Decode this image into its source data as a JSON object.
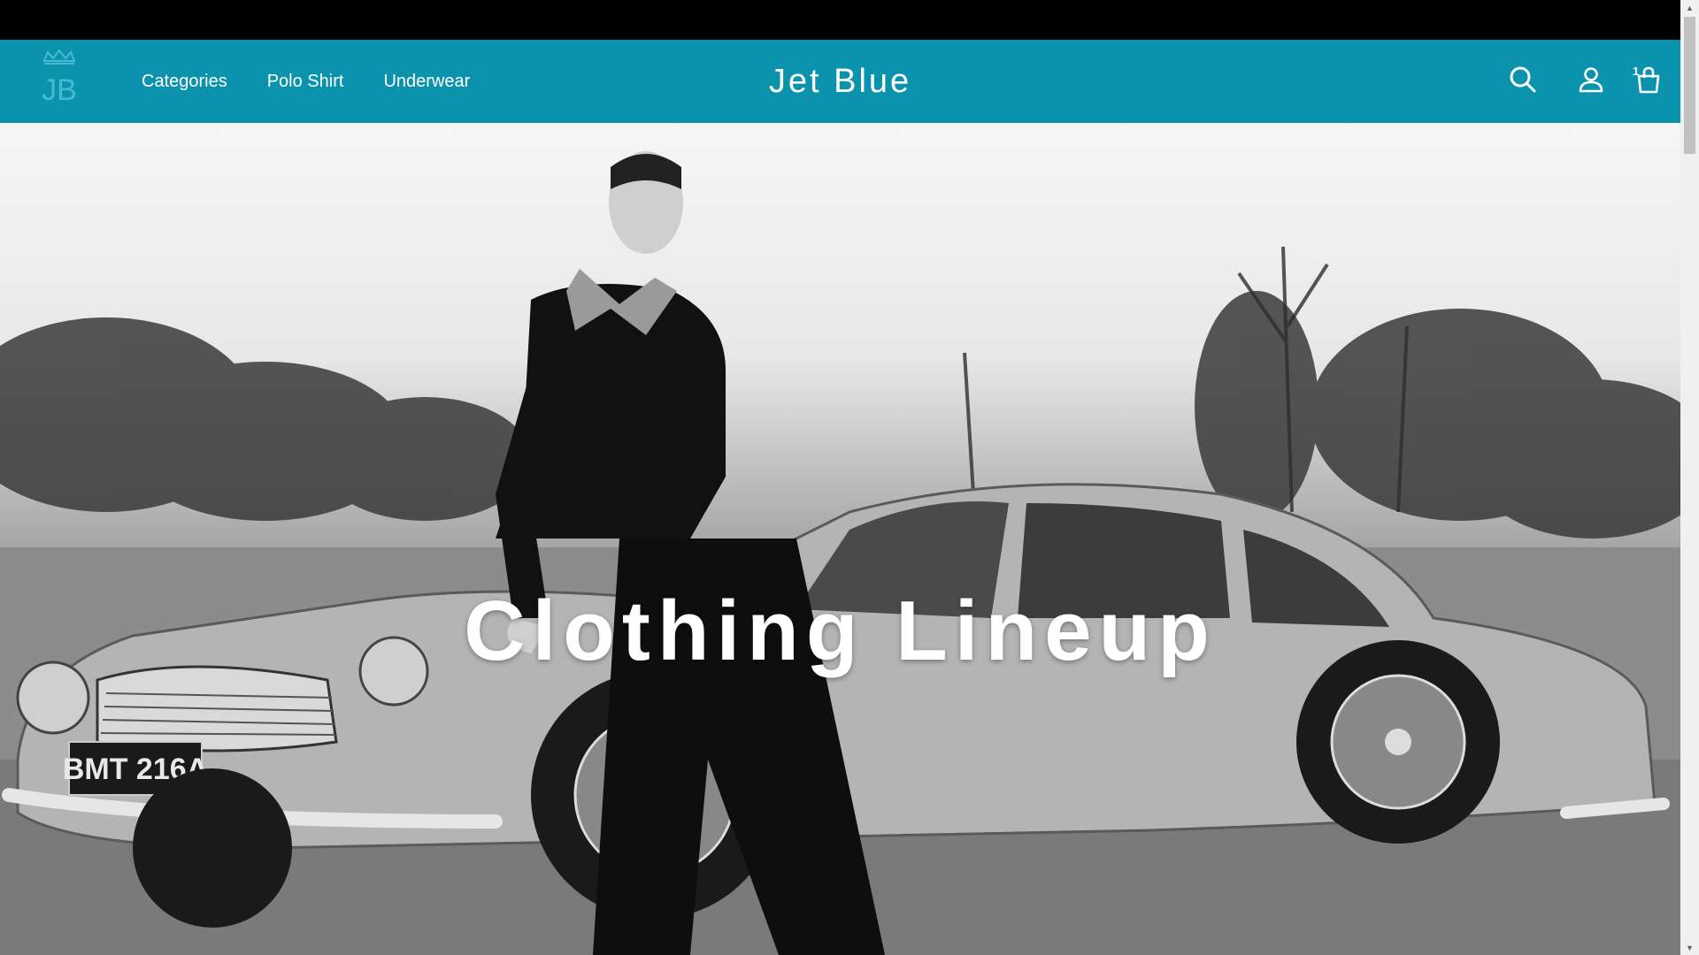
{
  "header": {
    "logo_text": "JB",
    "brand": "Jet Blue",
    "nav": [
      {
        "label": "Categories"
      },
      {
        "label": "Polo Shirt"
      },
      {
        "label": "Underwear"
      }
    ],
    "cart_count": "1",
    "icons": [
      "search-icon",
      "account-icon",
      "cart-icon"
    ]
  },
  "hero": {
    "title": "Clothing Lineup",
    "plate": "BMT 216A"
  },
  "colors": {
    "header_bg": "#0b93ad",
    "topbar_bg": "#000000",
    "text": "#ffffff"
  }
}
